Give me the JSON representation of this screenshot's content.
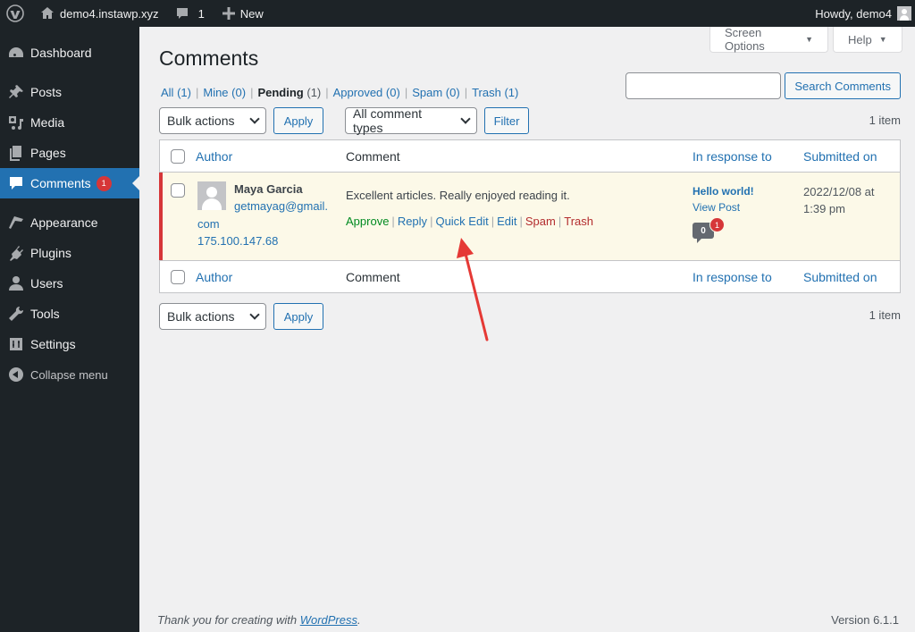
{
  "adminbar": {
    "site_name": "demo4.instawp.xyz",
    "comments_count": "1",
    "new_label": "New",
    "howdy": "Howdy, demo4"
  },
  "sidebar": {
    "items": [
      {
        "label": "Dashboard",
        "icon": "dashboard-icon"
      },
      {
        "label": "Posts",
        "icon": "pin-icon"
      },
      {
        "label": "Media",
        "icon": "media-icon"
      },
      {
        "label": "Pages",
        "icon": "pages-icon"
      },
      {
        "label": "Comments",
        "icon": "comment-icon",
        "badge": "1",
        "current": true
      },
      {
        "label": "Appearance",
        "icon": "paintbrush-icon"
      },
      {
        "label": "Plugins",
        "icon": "plugin-icon"
      },
      {
        "label": "Users",
        "icon": "user-icon"
      },
      {
        "label": "Tools",
        "icon": "wrench-icon"
      },
      {
        "label": "Settings",
        "icon": "settings-icon"
      }
    ],
    "collapse_label": "Collapse menu"
  },
  "screen_meta": {
    "screen_options": "Screen Options",
    "help": "Help"
  },
  "page": {
    "title": "Comments",
    "filters": [
      {
        "label": "All",
        "count": "(1)"
      },
      {
        "label": "Mine",
        "count": "(0)"
      },
      {
        "label": "Pending",
        "count": "(1)",
        "current": true
      },
      {
        "label": "Approved",
        "count": "(0)"
      },
      {
        "label": "Spam",
        "count": "(0)"
      },
      {
        "label": "Trash",
        "count": "(1)"
      }
    ],
    "search": {
      "value": "",
      "button": "Search Comments"
    },
    "bulk_actions": "Bulk actions",
    "apply": "Apply",
    "comment_types": "All comment types",
    "filter": "Filter",
    "items_count": "1 item"
  },
  "table": {
    "columns": [
      "Author",
      "Comment",
      "In response to",
      "Submitted on"
    ],
    "rows": [
      {
        "author_name": "Maya Garcia",
        "author_email_line1": "getmayag@gmail.",
        "author_email_line2": "com",
        "author_ip": "175.100.147.68",
        "comment": "Excellent articles. Really enjoyed reading it.",
        "actions": [
          "Approve",
          "Reply",
          "Quick Edit",
          "Edit",
          "Spam",
          "Trash"
        ],
        "post_title": "Hello world!",
        "view_post": "View Post",
        "approved_count": "0",
        "pending_count": "1",
        "date_line1": "2022/12/08 at",
        "date_line2": "1:39 pm"
      }
    ]
  },
  "footer": {
    "thanks_prefix": "Thank you for creating with ",
    "wordpress_link": "WordPress",
    "thanks_suffix": ".",
    "version": "Version 6.1.1"
  },
  "colors": {
    "accent": "#2271b1",
    "pending_bg": "#fcf9e8",
    "badge_red": "#d63638",
    "approve_green": "#008a20",
    "annotation_arrow": "#e53935"
  }
}
